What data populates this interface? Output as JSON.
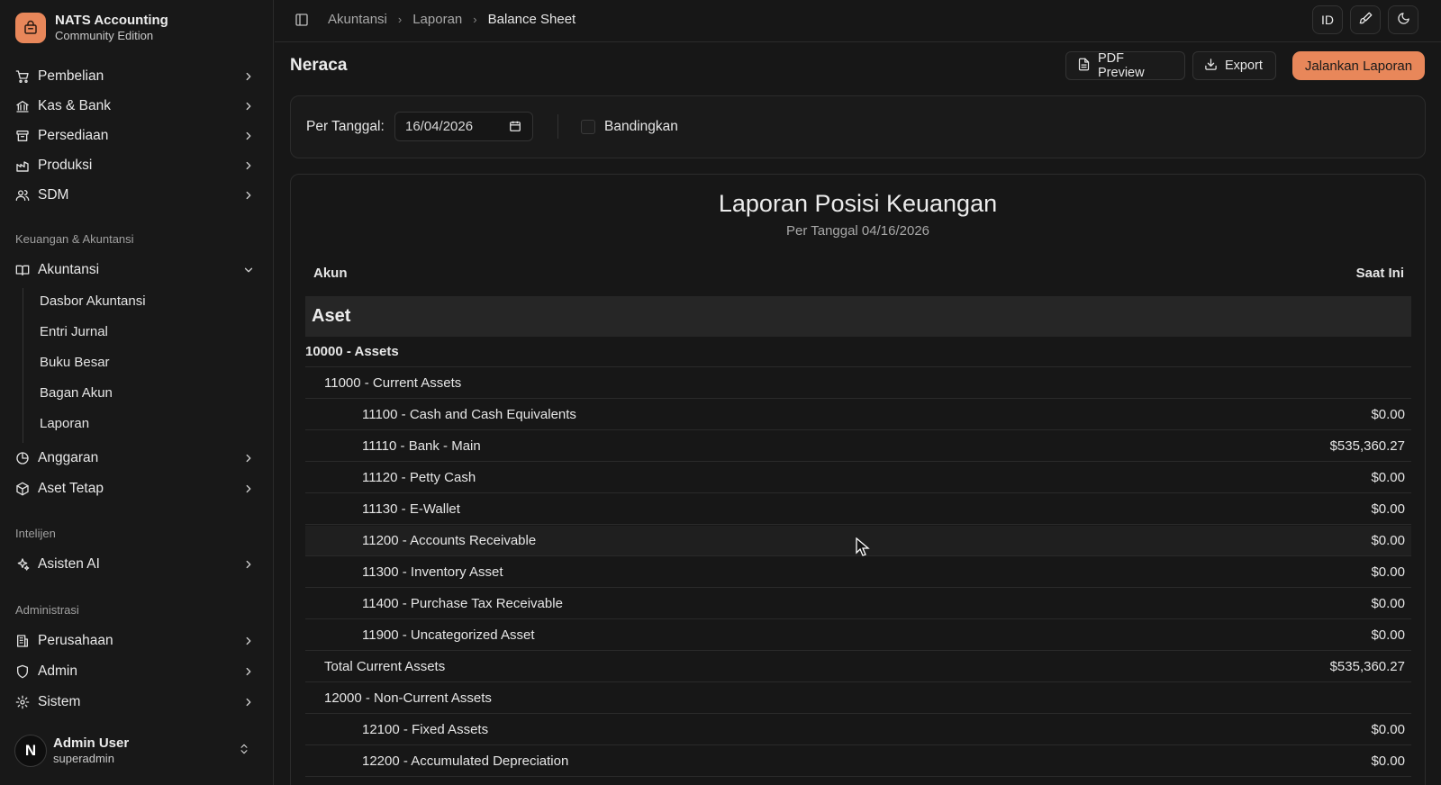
{
  "app": {
    "name": "NATS Accounting",
    "edition": "Community Edition",
    "brand_color": "#e8875a"
  },
  "sidebar": {
    "top_items": [
      {
        "label": "Pembelian",
        "icon": "cart-icon"
      },
      {
        "label": "Kas & Bank",
        "icon": "bank-icon"
      },
      {
        "label": "Persediaan",
        "icon": "archive-icon"
      },
      {
        "label": "Produksi",
        "icon": "factory-icon"
      },
      {
        "label": "SDM",
        "icon": "users-icon"
      }
    ],
    "section_finance": "Keuangan & Akuntansi",
    "accounting": {
      "label": "Akuntansi",
      "icon": "book-icon",
      "expanded": true
    },
    "accounting_sub": [
      "Dasbor Akuntansi",
      "Entri Jurnal",
      "Buku Besar",
      "Bagan Akun",
      "Laporan"
    ],
    "finance_more": [
      {
        "label": "Anggaran",
        "icon": "pie-icon"
      },
      {
        "label": "Aset Tetap",
        "icon": "box-icon"
      }
    ],
    "section_intel": "Intelijen",
    "intel_items": [
      {
        "label": "Asisten AI",
        "icon": "sparkles-icon"
      }
    ],
    "section_admin": "Administrasi",
    "admin_items": [
      {
        "label": "Perusahaan",
        "icon": "building-icon"
      },
      {
        "label": "Admin",
        "icon": "shield-icon"
      },
      {
        "label": "Sistem",
        "icon": "gear-icon"
      }
    ],
    "user": {
      "initial": "N",
      "name": "Admin User",
      "role": "superadmin"
    }
  },
  "topbar": {
    "breadcrumbs": [
      "Akuntansi",
      "Laporan",
      "Balance Sheet"
    ],
    "lang": "ID"
  },
  "header": {
    "title": "Neraca",
    "pdf_preview": "PDF Preview",
    "export": "Export",
    "run_report": "Jalankan Laporan"
  },
  "filter": {
    "date_label": "Per Tanggal:",
    "date_value": "16/04/2026",
    "compare_label": "Bandingkan",
    "compare_checked": false
  },
  "report": {
    "title": "Laporan Posisi Keuangan",
    "subtitle": "Per Tanggal 04/16/2026",
    "col_account": "Akun",
    "col_current": "Saat Ini",
    "section": "Aset",
    "rows": [
      {
        "name": "10000 - Assets",
        "amount": "",
        "level": 0,
        "bold": true
      },
      {
        "name": "11000 - Current Assets",
        "amount": "",
        "level": 1
      },
      {
        "name": "11100 - Cash and Cash Equivalents",
        "amount": "$0.00",
        "level": 2
      },
      {
        "name": "11110 - Bank - Main",
        "amount": "$535,360.27",
        "level": 2
      },
      {
        "name": "11120 - Petty Cash",
        "amount": "$0.00",
        "level": 2
      },
      {
        "name": "11130 - E-Wallet",
        "amount": "$0.00",
        "level": 2
      },
      {
        "name": "11200 - Accounts Receivable",
        "amount": "$0.00",
        "level": 2,
        "hover": true
      },
      {
        "name": "11300 - Inventory Asset",
        "amount": "$0.00",
        "level": 2
      },
      {
        "name": "11400 - Purchase Tax Receivable",
        "amount": "$0.00",
        "level": 2
      },
      {
        "name": "11900 - Uncategorized Asset",
        "amount": "$0.00",
        "level": 2
      },
      {
        "name": "Total Current Assets",
        "amount": "$535,360.27",
        "level": 1
      },
      {
        "name": "12000 - Non-Current Assets",
        "amount": "",
        "level": 1
      },
      {
        "name": "12100 - Fixed Assets",
        "amount": "$0.00",
        "level": 2
      },
      {
        "name": "12200 - Accumulated Depreciation",
        "amount": "$0.00",
        "level": 2
      },
      {
        "name": "",
        "amount": "",
        "level": 2
      }
    ]
  }
}
